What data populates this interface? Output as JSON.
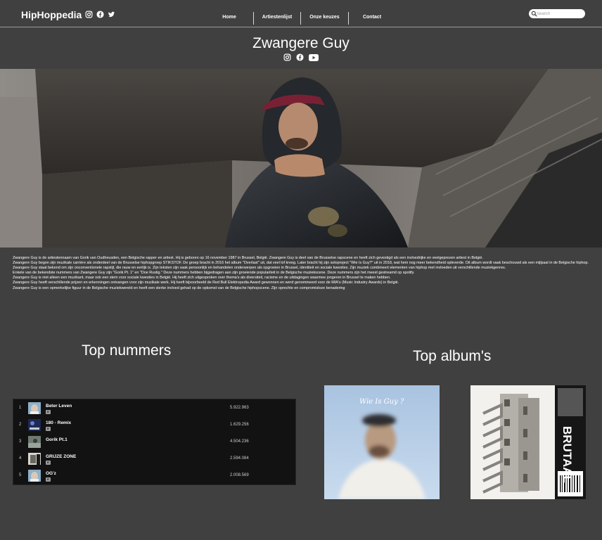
{
  "nav": {
    "brand": "HipHoppedia",
    "links": [
      "Home",
      "Artiestenlijst",
      "Onze keuzes",
      "Contact"
    ],
    "search_placeholder": "Search",
    "social_icons": [
      "instagram-icon",
      "facebook-icon",
      "twitter-icon"
    ]
  },
  "artist": {
    "name": "Zwangere Guy",
    "social_icons": [
      "instagram-icon",
      "facebook-icon",
      "youtube-icon"
    ]
  },
  "bio": [
    "Zwangere Guy is de artiestennaam van Gorik van Oudheusden, een Belgische rapper en artiest. Hij is geboren op 16 november 1987 in Brussel, België. Zwangere Guy is deel van de Brusselse rapscene en heeft zich gevestigd als een invloedrijke en veelgeprezen artiest in België.",
    "Zwangere Guy begon zijn muzikale carrière als onderdeel van de Brusselse hiphopgroep STIKSTOF. De groep bracht in 2016 het album \"Overlast\" uit, dat veel lof kreeg. Later bracht hij zijn soloproject \"Wie Is Guy?\" uit in 2018, wat hem nog meer bekendheid opleverde. Dit album wordt vaak beschouwd als een mijlpaal in de Belgische hiphop.",
    "Zwangere Guy staat bekend om zijn onconventionele rapstijl, die rauw en eerlijk is. Zijn teksten zijn vaak persoonlijk en behandelen onderwerpen als opgroeien in Brussel, identiteit en sociale kwesties. Zijn muziek combineert elementen van hiphop met invloeden uit verschillende muziekgenres.",
    "Enkele van de bekendste nummers van Zwangere Guy zijn \"Gorik Pt. 1\" en \"Doe Rustig.\" Deze nummers hebben bijgedragen aan zijn groeiende populariteit in de Belgische muziekscene. Deze nummers zijn het meest gestreamd op spotify.",
    "Zwangere Guy is niet alleen een muzikant, maar ook een stem voor sociale kwesties in België. Hij heeft zich uitgesproken over thema's als diversiteit, racisme en de uitdagingen waarmee jongeren in Brussel te maken hebben.",
    "Zwangere Guy heeft verschillende prijzen en erkenningen ontvangen voor zijn muzikale werk. Hij heeft bijvoorbeeld de Red Bull Elektropedia Award gewonnen en werd genomineerd voor de MIA's (Music Industry Awards) in België.",
    "Zwangere Guy is een opmerkelijke figuur in de Belgische muziekwereld en heeft een sterke invloed gehad op de opkomst van de Belgische hiphopscene. Zijn oprechte en compromisloze benadering"
  ],
  "sections": {
    "top_tracks_title": "Top nummers",
    "top_albums_title": "Top album's"
  },
  "tracks": [
    {
      "num": "1",
      "title": "Beter Leven",
      "badge": "E",
      "plays": "5.922.963"
    },
    {
      "num": "2",
      "title": "180 - Remix",
      "badge": "E",
      "plays": "1.629.256"
    },
    {
      "num": "3",
      "title": "Gorik Pt.1",
      "badge": "",
      "plays": "4.504.236"
    },
    {
      "num": "4",
      "title": "GRIJZE ZONE",
      "badge": "E",
      "plays": "2.594.084"
    },
    {
      "num": "5",
      "title": "OG'z",
      "badge": "E",
      "plays": "2.008.569"
    }
  ],
  "albums": [
    {
      "cover_text": "Wie Is Guy ?"
    },
    {
      "cover_text": "BRUTAAL"
    }
  ],
  "colors": {
    "page_bg": "#404040",
    "table_bg": "#121212",
    "text": "#ffffff"
  }
}
